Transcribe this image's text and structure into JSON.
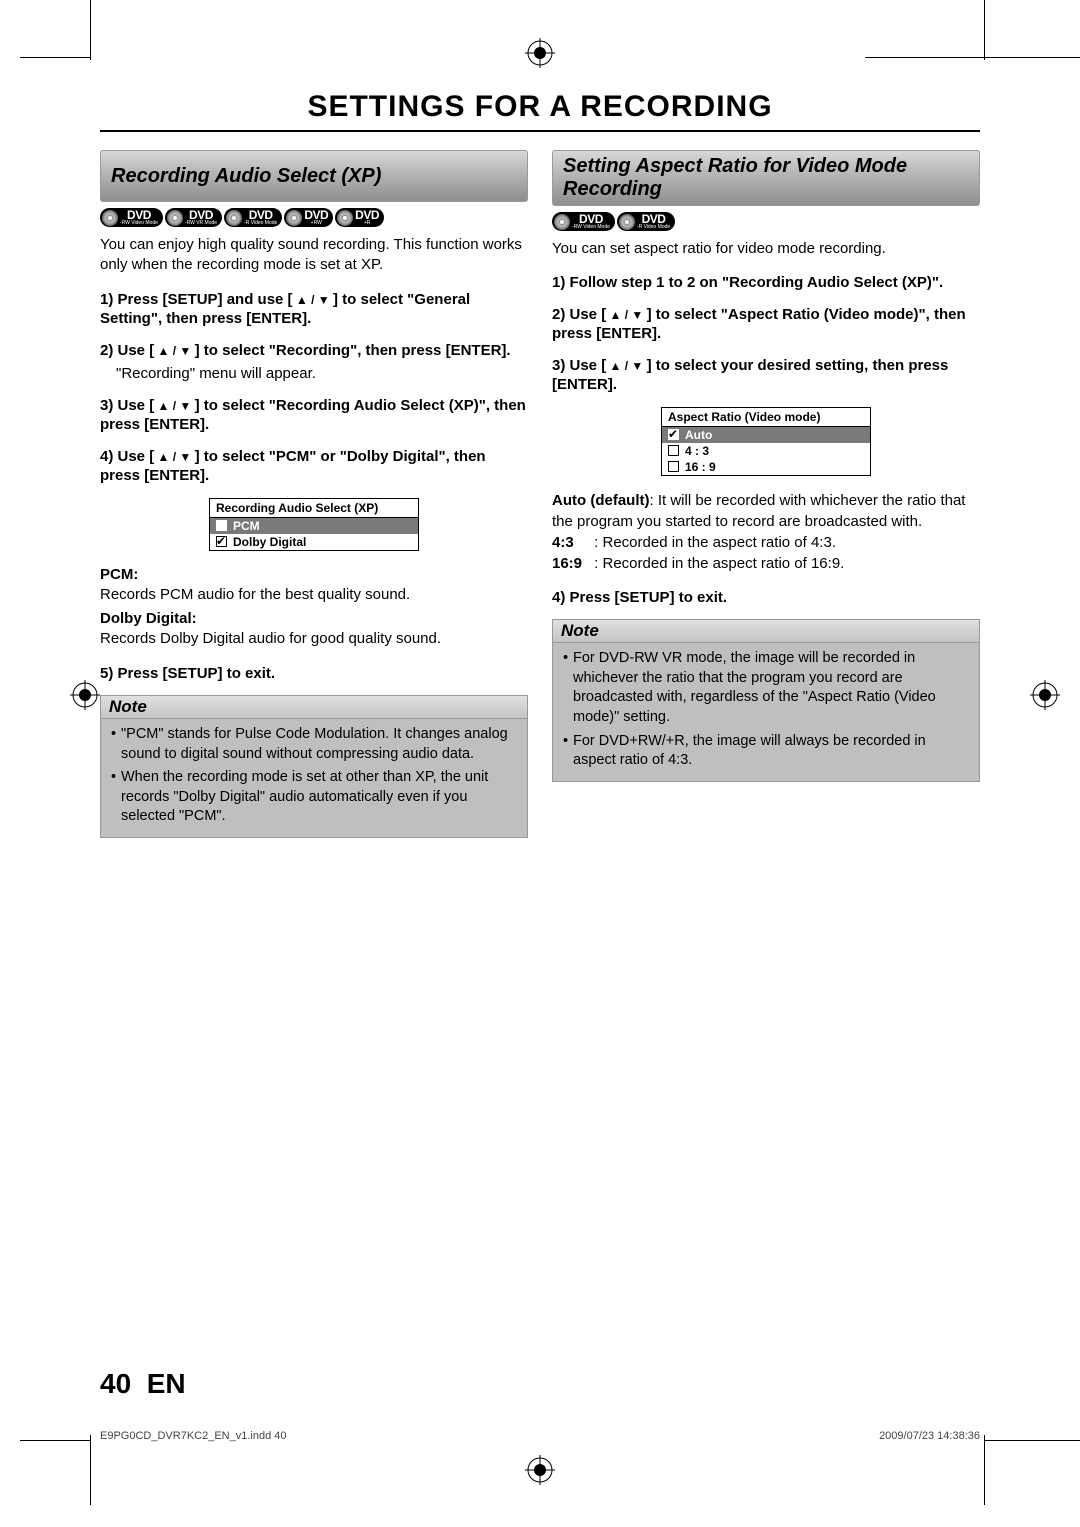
{
  "page_title": "SETTINGS FOR A RECORDING",
  "left": {
    "section_title": "Recording Audio Select (XP)",
    "badges": [
      {
        "main": "DVD",
        "sub1": "-RW",
        "sub2": "Video Mode"
      },
      {
        "main": "DVD",
        "sub1": "-RW",
        "sub2": "VR Mode"
      },
      {
        "main": "DVD",
        "sub1": "-R",
        "sub2": "Video Mode"
      },
      {
        "main": "DVD",
        "sub1": "",
        "sub2": "+RW"
      },
      {
        "main": "DVD",
        "sub1": "",
        "sub2": "+R"
      }
    ],
    "intro": "You can enjoy high quality sound recording. This function works only when the recording mode is set at XP.",
    "step1_a": "1) Press [SETUP] and use [",
    "step1_b": "] to select \"General Setting\", then press [ENTER].",
    "step2_a": "2) Use [",
    "step2_b": "] to select \"Recording\", then press [ENTER].",
    "step2_plain": "\"Recording\" menu will appear.",
    "step3_a": "3) Use [",
    "step3_b": "] to select \"Recording Audio Select (XP)\", then press [ENTER].",
    "step4_a": "4) Use [",
    "step4_b": "] to select \"PCM\" or \"Dolby Digital\", then press [ENTER].",
    "menu": {
      "title": "Recording Audio Select (XP)",
      "opt1": "PCM",
      "opt2": "Dolby Digital"
    },
    "pcm_t": "PCM:",
    "pcm_d": "Records PCM audio for the best quality sound.",
    "dd_t": "Dolby Digital:",
    "dd_d": "Records Dolby Digital audio for good quality sound.",
    "step5": "5) Press [SETUP] to exit.",
    "note_label": "Note",
    "note1": "\"PCM\" stands for Pulse Code Modulation. It changes analog sound to digital sound without compressing audio data.",
    "note2": "When the recording mode is set at other than XP, the unit records \"Dolby Digital\" audio automatically even if you selected \"PCM\"."
  },
  "right": {
    "section_title": "Setting Aspect Ratio for Video Mode Recording",
    "badges": [
      {
        "main": "DVD",
        "sub1": "-RW",
        "sub2": "Video Mode"
      },
      {
        "main": "DVD",
        "sub1": "-R",
        "sub2": "Video Mode"
      }
    ],
    "intro": "You can set aspect ratio for video mode recording.",
    "step1": "1) Follow step 1 to 2 on \"Recording Audio Select (XP)\".",
    "step2_a": "2) Use [",
    "step2_b": "] to select \"Aspect Ratio (Video mode)\", then press [ENTER].",
    "step3_a": "3) Use [",
    "step3_b": "] to select your desired setting, then press [ENTER].",
    "menu": {
      "title": "Aspect Ratio (Video mode)",
      "opt1": "Auto",
      "opt2": "4 : 3",
      "opt3": "16 : 9"
    },
    "auto_t": "Auto (default)",
    "auto_d": ": It will be recorded with whichever the ratio that the program you started to record are broadcasted with.",
    "r43_t": "4:3",
    "r43_d": ":   Recorded in the aspect ratio of 4:3.",
    "r169_t": "16:9",
    "r169_d": ":  Recorded in the aspect ratio of 16:9.",
    "step4": "4) Press [SETUP] to exit.",
    "note_label": "Note",
    "note1": "For DVD-RW VR mode, the image will be recorded in whichever the ratio that the program you record are broadcasted with, regardless of the \"Aspect Ratio (Video mode)\" setting.",
    "note2": "For DVD+RW/+R, the image will always be recorded in aspect ratio of 4:3."
  },
  "arrows": " ▲ / ▼ ",
  "footer": {
    "page_num": "40",
    "lang": "EN",
    "file": "E9PG0CD_DVR7KC2_EN_v1.indd   40",
    "date": "2009/07/23   14:38:36"
  }
}
